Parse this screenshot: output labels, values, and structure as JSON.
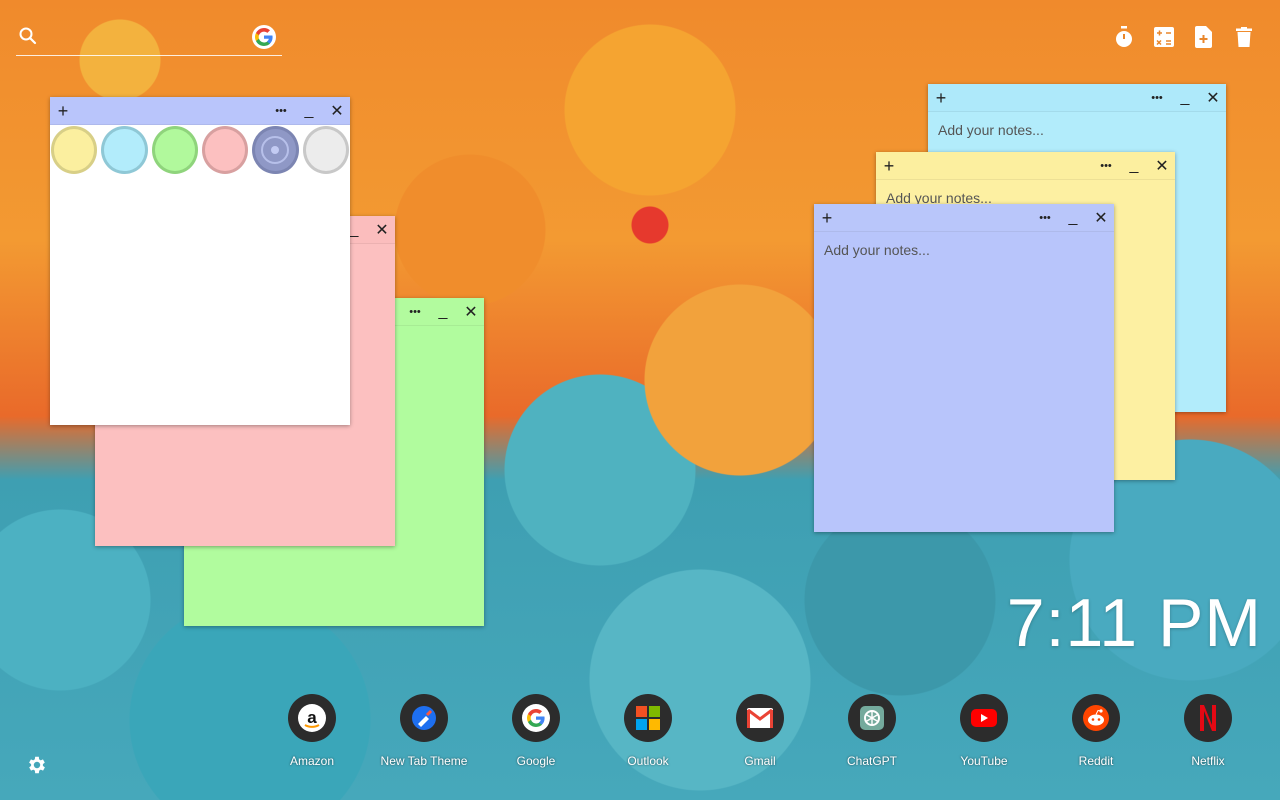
{
  "search": {
    "icon": "search-icon",
    "engine_icon": "google-icon"
  },
  "toolbar": {
    "items": [
      {
        "icon": "timer-icon"
      },
      {
        "icon": "calculator-icon"
      },
      {
        "icon": "add-document-icon"
      },
      {
        "icon": "trash-icon"
      }
    ]
  },
  "notes": {
    "add_label": "+",
    "more_label": "•••",
    "minimize_label": "_",
    "close_label": "✕",
    "placeholder": "Add your notes...",
    "colors": {
      "yellow": "#fdf0a2",
      "cyan": "#b2ecfb",
      "green": "#b1fc9e",
      "pink": "#fcc0c0",
      "blue": "#b8c5fb",
      "white": "#ffffff"
    },
    "swatches": [
      "#fbef9f",
      "#b2ecfb",
      "#b1f99c",
      "#fcc0c0",
      "#8f98c6",
      "#e8e8e8"
    ]
  },
  "clock": {
    "time": "7:11 PM"
  },
  "dock": {
    "items": [
      {
        "label": "Amazon",
        "icon": "amazon-icon"
      },
      {
        "label": "New Tab Theme",
        "icon": "new-tab-theme-icon"
      },
      {
        "label": "Google",
        "icon": "google-icon"
      },
      {
        "label": "Outlook",
        "icon": "outlook-icon"
      },
      {
        "label": "Gmail",
        "icon": "gmail-icon"
      },
      {
        "label": "ChatGPT",
        "icon": "chatgpt-icon"
      },
      {
        "label": "YouTube",
        "icon": "youtube-icon"
      },
      {
        "label": "Reddit",
        "icon": "reddit-icon"
      },
      {
        "label": "Netflix",
        "icon": "netflix-icon"
      }
    ]
  },
  "settings": {
    "icon": "gear-icon"
  }
}
